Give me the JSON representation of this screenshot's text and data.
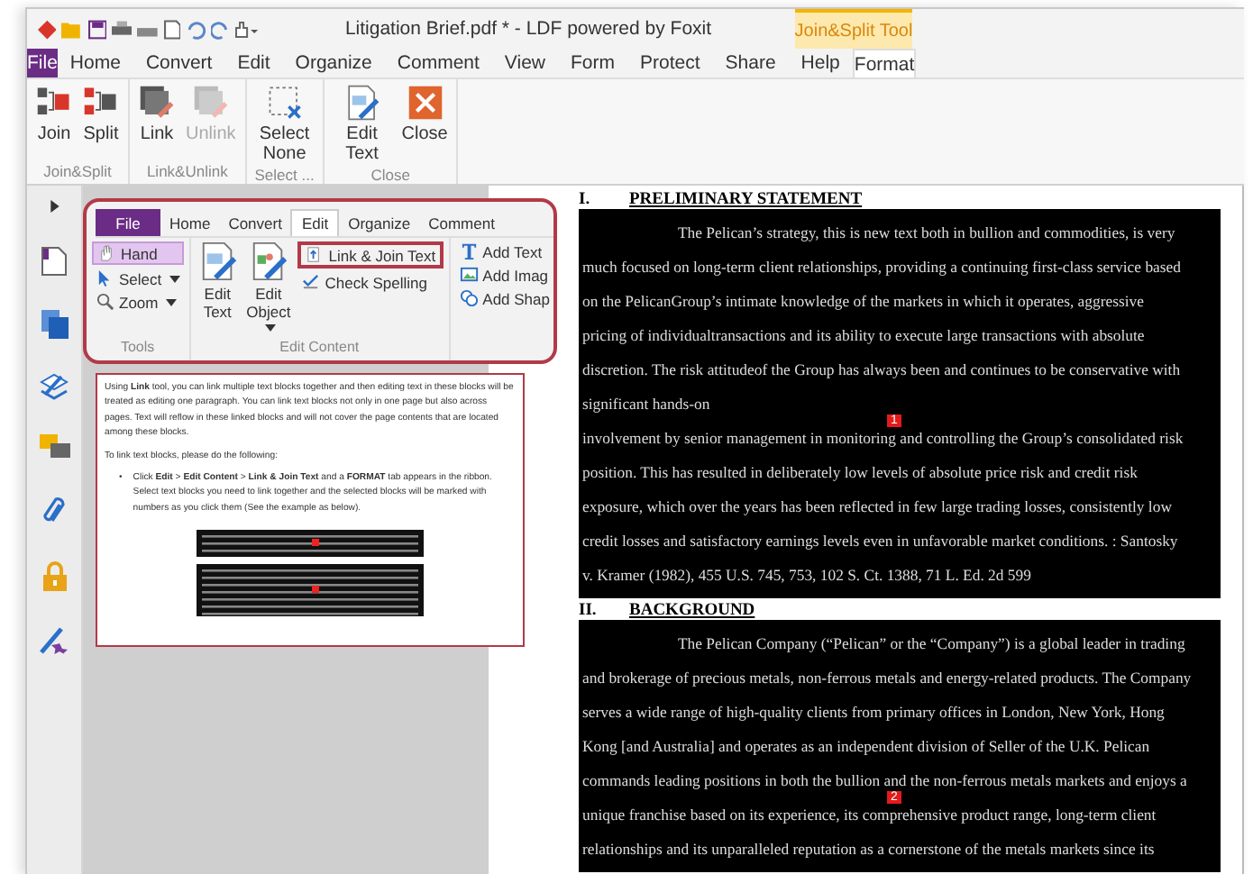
{
  "window": {
    "title": "Litigation Brief.pdf * - LDF powered by Foxit",
    "context_tab": "Join&Split Tool"
  },
  "tabs": [
    {
      "label": "File",
      "kind": "file",
      "selected": false
    },
    {
      "label": "Home",
      "kind": "tab",
      "selected": false
    },
    {
      "label": "Convert",
      "kind": "tab",
      "selected": false
    },
    {
      "label": "Edit",
      "kind": "tab",
      "selected": false
    },
    {
      "label": "Organize",
      "kind": "tab",
      "selected": false
    },
    {
      "label": "Comment",
      "kind": "tab",
      "selected": false
    },
    {
      "label": "View",
      "kind": "tab",
      "selected": false
    },
    {
      "label": "Form",
      "kind": "tab",
      "selected": false
    },
    {
      "label": "Protect",
      "kind": "tab",
      "selected": false
    },
    {
      "label": "Share",
      "kind": "tab",
      "selected": false
    },
    {
      "label": "Help",
      "kind": "tab",
      "selected": false
    },
    {
      "label": "Format",
      "kind": "context",
      "selected": true
    }
  ],
  "ribbon_groups": [
    {
      "label": "Join&Split",
      "buttons": [
        {
          "label": "Join",
          "kind": "join",
          "disabled": false
        },
        {
          "label": "Split",
          "kind": "split",
          "disabled": false
        }
      ]
    },
    {
      "label": "Link&Unlink",
      "buttons": [
        {
          "label": "Link",
          "kind": "link",
          "disabled": false
        },
        {
          "label": "Unlink",
          "kind": "unlink",
          "disabled": true
        }
      ]
    },
    {
      "label": "Select ...",
      "buttons": [
        {
          "label": "Select None",
          "kind": "select-none",
          "disabled": false
        }
      ]
    },
    {
      "label": "Close",
      "buttons": [
        {
          "label": "Edit Text",
          "kind": "edit-text",
          "disabled": false
        },
        {
          "label": "Close",
          "kind": "close",
          "disabled": false
        }
      ]
    }
  ],
  "guide_image": {
    "tabs": [
      {
        "label": "File",
        "kind": "file",
        "selected": false
      },
      {
        "label": "Home",
        "kind": "tab",
        "selected": false
      },
      {
        "label": "Convert",
        "kind": "tab",
        "selected": false
      },
      {
        "label": "Edit",
        "kind": "tab",
        "selected": true
      },
      {
        "label": "Organize",
        "kind": "tab",
        "selected": false
      },
      {
        "label": "Comment",
        "kind": "tab",
        "selected": false
      }
    ],
    "tools": {
      "label": "Tools",
      "items": [
        {
          "label": "Hand",
          "kind": "hand",
          "selected": true,
          "dropdown": false
        },
        {
          "label": "Select",
          "kind": "select",
          "selected": false,
          "dropdown": true
        },
        {
          "label": "Zoom",
          "kind": "zoom",
          "selected": false,
          "dropdown": true
        }
      ]
    },
    "edit_content": {
      "label": "Edit Content",
      "large": [
        {
          "label": "Edit Text",
          "kind": "edit-text",
          "dropdown": false
        },
        {
          "label": "Edit Object",
          "kind": "edit-object",
          "dropdown": true
        }
      ],
      "small": [
        {
          "label": "Link & Join Text",
          "kind": "link-join",
          "highlighted": true
        },
        {
          "label": "Check Spelling",
          "kind": "spell",
          "highlighted": false
        }
      ]
    },
    "add_items": [
      {
        "label": "Add Text",
        "kind": "add-text"
      },
      {
        "label": "Add Imag",
        "kind": "add-image"
      },
      {
        "label": "Add Shap",
        "kind": "add-shape"
      }
    ]
  },
  "help": {
    "paragraphs": [
      "Using **Link** tool, you can link multiple text blocks together and then editing text in these blocks will be treated as editing one paragraph. You can link text blocks not only in one page but also across pages. Text will reflow in these linked blocks and will not cover the page contents that are located among these blocks.",
      "To link text blocks, please do the following:"
    ],
    "bullets": [
      {
        "mark": "•",
        "text": "Click **Edit** > **Edit Content** > **Link & Join Text** and a **FORMAT** tab appears in the ribbon. Select text blocks you need to link together and the selected blocks will be marked with numbers as you click them (See the example as below)."
      }
    ]
  },
  "document": {
    "sections": [
      {
        "number": "I.",
        "heading": "PRELIMINARY STATEMENT",
        "lines": [
          {
            "text": "The Pelican’s strategy, this is new text both in bullion and commodities, is very",
            "indent": true
          },
          {
            "text": "much focused on long-term client relationships, providing a continuing first-class service based",
            "indent": false
          },
          {
            "text": "on the PelicanGroup’s intimate knowledge of the markets in which it operates, aggressive",
            "indent": false
          },
          {
            "text": "pricing of individualtransactions and its ability to execute large transactions with absolute",
            "indent": false
          },
          {
            "text": "discretion. The risk attitudeof the Group has always been and continues to be conservative with",
            "indent": false
          },
          {
            "text": "significant hands-on",
            "indent": false
          },
          {
            "text": "involvement by senior management in monitoring and controlling the Group’s consolidated risk",
            "indent": false,
            "marker": "1"
          },
          {
            "text": "position. This has resulted in deliberately low levels of absolute price risk and credit risk",
            "indent": false
          },
          {
            "text": "exposure, which over the years has been reflected in few large trading losses, consistently low",
            "indent": false
          },
          {
            "text": "credit losses and satisfactory earnings levels even in unfavorable market conditions. : Santosky",
            "indent": false
          },
          {
            "text": "v. Kramer (1982), 455 U.S. 745, 753, 102 S. Ct. 1388, 71 L. Ed. 2d 599",
            "indent": false
          }
        ]
      },
      {
        "number": "II.",
        "heading": "BACKGROUND",
        "lines": [
          {
            "text": "The Pelican Company (“Pelican” or the “Company”) is a global leader in trading",
            "indent": true
          },
          {
            "text": "and brokerage of precious metals, non-ferrous metals and energy-related products. The Company",
            "indent": false
          },
          {
            "text": "serves a wide range of high-quality clients from primary offices in London, New York, Hong",
            "indent": false
          },
          {
            "text": "Kong [and Australia] and operates as an independent division of Seller of the U.K. Pelican",
            "indent": false
          },
          {
            "text": "commands leading positions in both the bullion and the non-ferrous metals markets and enjoys a",
            "indent": false
          },
          {
            "text": "unique franchise based on its experience, its comprehensive product range, long-term client",
            "indent": false,
            "marker": "2"
          },
          {
            "text": "relationships and its unparalleled reputation as a cornerstone of the metals markets since its",
            "indent": false
          }
        ]
      }
    ]
  }
}
